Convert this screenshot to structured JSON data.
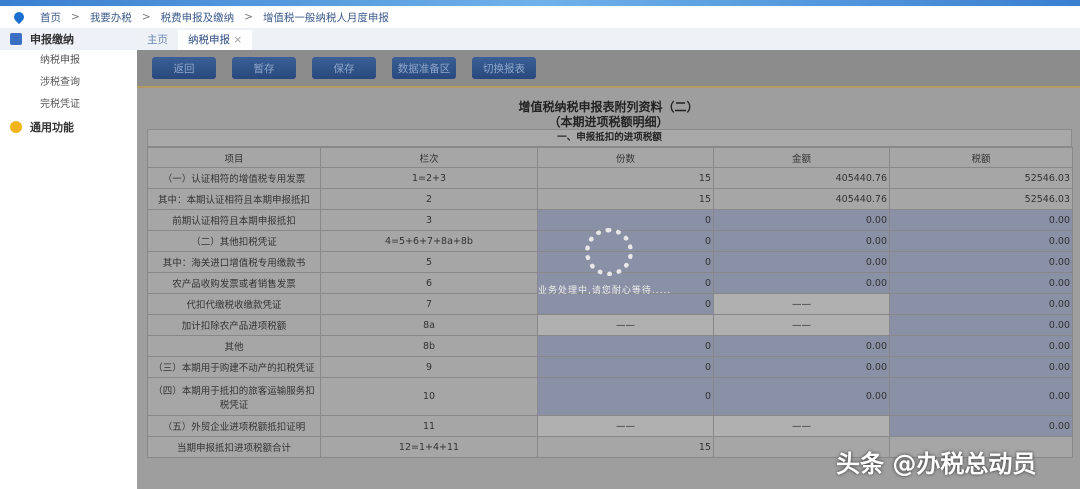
{
  "breadcrumb": [
    "首页",
    "我要办税",
    "税费申报及缴纳",
    "增值税一般纳税人月度申报"
  ],
  "sidebar": {
    "group1": "申报缴纳",
    "items": [
      "纳税申报",
      "涉税查询",
      "完税凭证"
    ],
    "group2": "通用功能"
  },
  "tabs": [
    {
      "label": "主页"
    },
    {
      "label": "纳税申报",
      "close": "×"
    }
  ],
  "toolbar": [
    "返回",
    "暂存",
    "保存",
    "数据准备区",
    "切换报表"
  ],
  "form": {
    "title": "增值税纳税申报表附列资料（二）",
    "subtitle": "（本期进项税额明细）",
    "section": "一、申报抵扣的进项税额",
    "headers": [
      "项目",
      "栏次",
      "份数",
      "金额",
      "税额"
    ],
    "rows": [
      [
        "（一）认证相符的增值税专用发票",
        "1=2+3",
        "15",
        "405440.76",
        "52546.03"
      ],
      [
        "其中：本期认证相符且本期申报抵扣",
        "2",
        "15",
        "405440.76",
        "52546.03"
      ],
      [
        "前期认证相符且本期申报抵扣",
        "3",
        "0",
        "0.00",
        "0.00"
      ],
      [
        "（二）其他扣税凭证",
        "4=5+6+7+8a+8b",
        "0",
        "0.00",
        "0.00"
      ],
      [
        "其中：海关进口增值税专用缴款书",
        "5",
        "0",
        "0.00",
        "0.00"
      ],
      [
        "农产品收购发票或者销售发票",
        "6",
        "0",
        "0.00",
        "0.00"
      ],
      [
        "代扣代缴税收缴款凭证",
        "7",
        "0",
        "——",
        "0.00"
      ],
      [
        "加计扣除农产品进项税额",
        "8a",
        "——",
        "——",
        "0.00"
      ],
      [
        "其他",
        "8b",
        "0",
        "0.00",
        "0.00"
      ],
      [
        "（三）本期用于购建不动产的扣税凭证",
        "9",
        "0",
        "0.00",
        "0.00"
      ],
      [
        "（四）本期用于抵扣的旅客运输服务扣税凭证",
        "10",
        "0",
        "0.00",
        "0.00"
      ],
      [
        "（五）外贸企业进项税额抵扣证明",
        "11",
        "——",
        "——",
        "0.00"
      ],
      [
        "当期申报抵扣进项税额合计",
        "12=1+4+11",
        "15",
        "",
        ""
      ]
    ]
  },
  "loading_text": "业务处理中,请您耐心等待.....",
  "watermark": "头条 @办税总动员"
}
